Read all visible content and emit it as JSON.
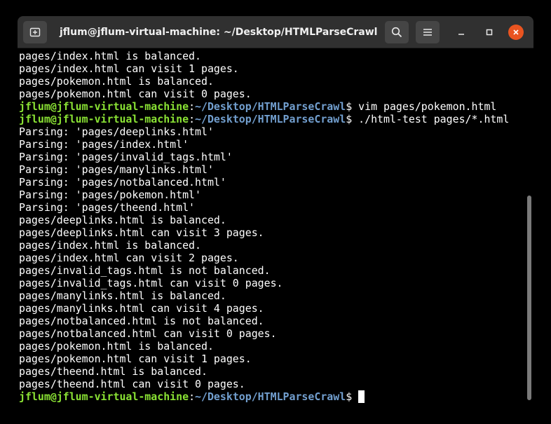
{
  "window": {
    "title": "jflum@jflum-virtual-machine: ~/Desktop/HTMLParseCrawl",
    "icons": {
      "new_tab": "new-tab-icon",
      "search": "search-icon",
      "menu": "hamburger-menu-icon",
      "minimize": "minimize-icon",
      "maximize": "maximize-icon",
      "close": "close-icon"
    },
    "colors": {
      "titlebar": "#303030",
      "button": "#454545",
      "close": "#e95420",
      "prompt_user": "#8ae234",
      "prompt_path": "#729fcf"
    }
  },
  "terminal": {
    "prompt": {
      "user": "jflum@jflum-virtual-machine",
      "sep": ":",
      "path": "~/Desktop/HTMLParseCrawl",
      "symbol": "$ "
    },
    "lines": [
      {
        "type": "output",
        "text": "pages/index.html is balanced."
      },
      {
        "type": "output",
        "text": "pages/index.html can visit 1 pages."
      },
      {
        "type": "output",
        "text": "pages/pokemon.html is balanced."
      },
      {
        "type": "output",
        "text": "pages/pokemon.html can visit 0 pages."
      },
      {
        "type": "prompt",
        "cmd": "vim pages/pokemon.html"
      },
      {
        "type": "prompt",
        "cmd": "./html-test pages/*.html"
      },
      {
        "type": "output",
        "text": "Parsing: 'pages/deeplinks.html'"
      },
      {
        "type": "output",
        "text": "Parsing: 'pages/index.html'"
      },
      {
        "type": "output",
        "text": "Parsing: 'pages/invalid_tags.html'"
      },
      {
        "type": "output",
        "text": "Parsing: 'pages/manylinks.html'"
      },
      {
        "type": "output",
        "text": "Parsing: 'pages/notbalanced.html'"
      },
      {
        "type": "output",
        "text": "Parsing: 'pages/pokemon.html'"
      },
      {
        "type": "output",
        "text": "Parsing: 'pages/theend.html'"
      },
      {
        "type": "output",
        "text": "pages/deeplinks.html is balanced."
      },
      {
        "type": "output",
        "text": "pages/deeplinks.html can visit 3 pages."
      },
      {
        "type": "output",
        "text": "pages/index.html is balanced."
      },
      {
        "type": "output",
        "text": "pages/index.html can visit 2 pages."
      },
      {
        "type": "output",
        "text": "pages/invalid_tags.html is not balanced."
      },
      {
        "type": "output",
        "text": "pages/invalid_tags.html can visit 0 pages."
      },
      {
        "type": "output",
        "text": "pages/manylinks.html is balanced."
      },
      {
        "type": "output",
        "text": "pages/manylinks.html can visit 4 pages."
      },
      {
        "type": "output",
        "text": "pages/notbalanced.html is not balanced."
      },
      {
        "type": "output",
        "text": "pages/notbalanced.html can visit 0 pages."
      },
      {
        "type": "output",
        "text": "pages/pokemon.html is balanced."
      },
      {
        "type": "output",
        "text": "pages/pokemon.html can visit 1 pages."
      },
      {
        "type": "output",
        "text": "pages/theend.html is balanced."
      },
      {
        "type": "output",
        "text": "pages/theend.html can visit 0 pages."
      },
      {
        "type": "prompt",
        "cmd": "",
        "cursor": true
      }
    ]
  }
}
